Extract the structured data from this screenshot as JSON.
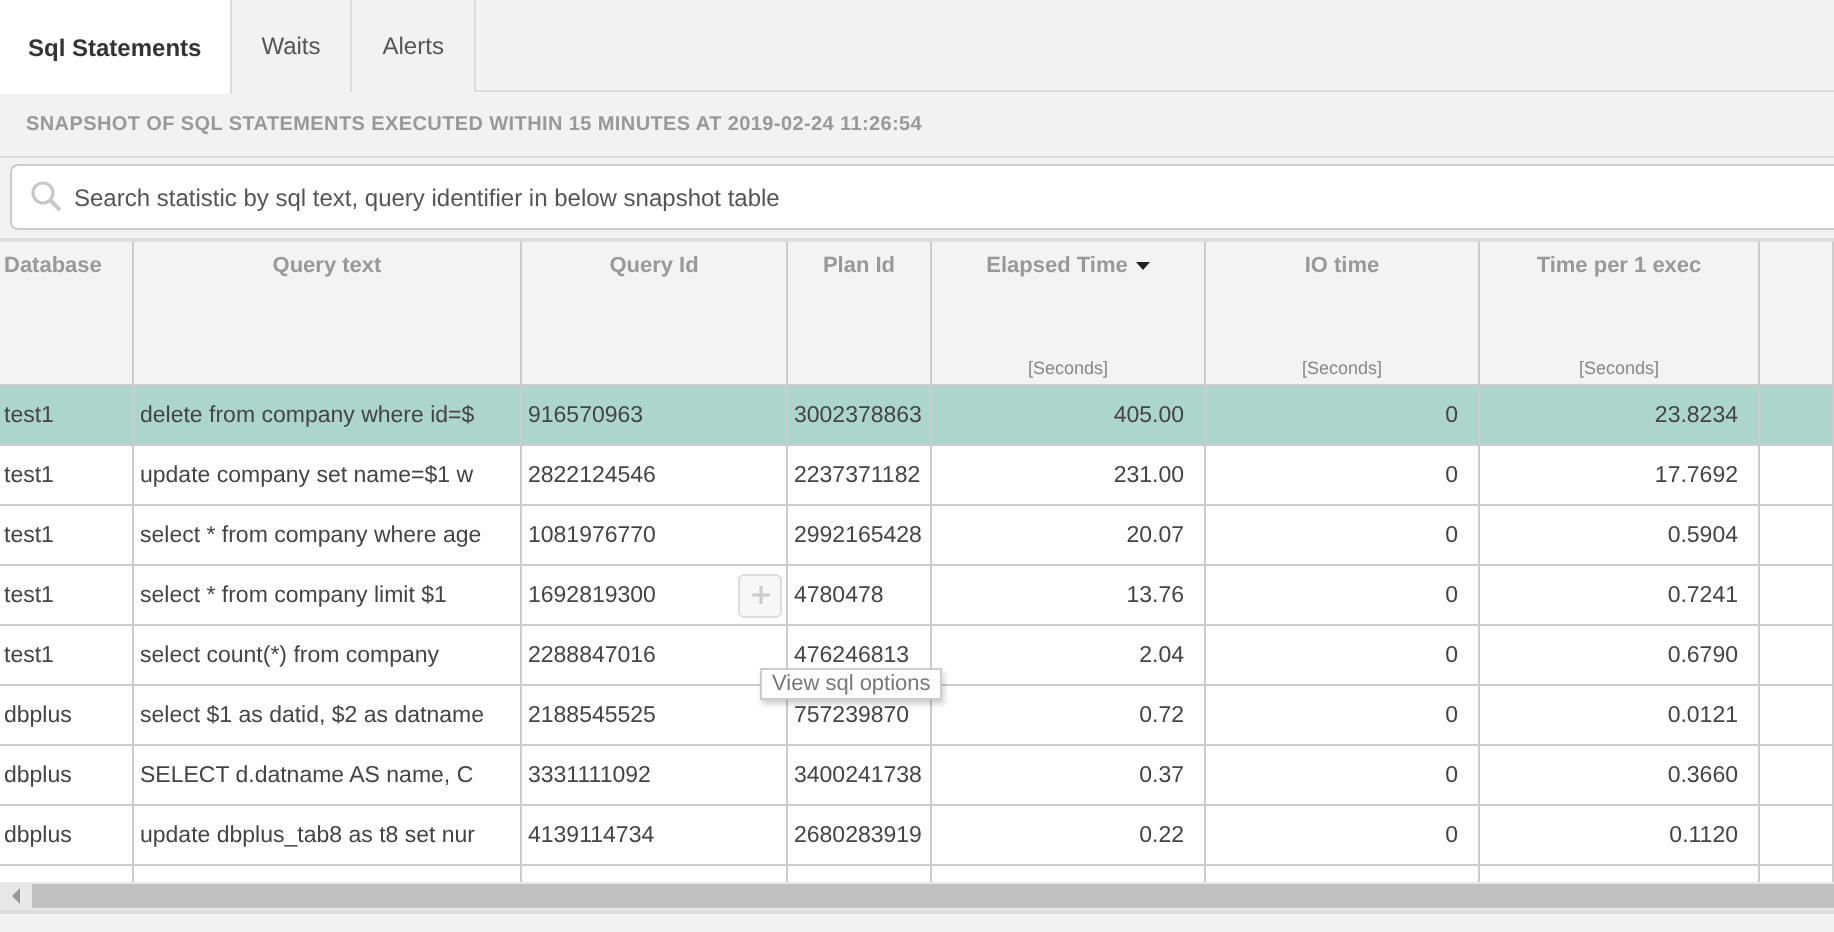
{
  "tabs": [
    {
      "label": "Sql Statements",
      "selected": true
    },
    {
      "label": "Waits",
      "selected": false
    },
    {
      "label": "Alerts",
      "selected": false
    }
  ],
  "snapshot_title": "SNAPSHOT OF SQL STATEMENTS EXECUTED WITHIN 15 MINUTES AT 2019-02-24 11:26:54",
  "search": {
    "placeholder": "Search statistic by sql text, query identifier in below snapshot table"
  },
  "table": {
    "columns": [
      {
        "label": "Database",
        "sorted": false
      },
      {
        "label": "Query text",
        "sorted": false
      },
      {
        "label": "Query Id",
        "sorted": false
      },
      {
        "label": "Plan Id",
        "sorted": false
      },
      {
        "label": "Elapsed Time",
        "unit": "[Seconds]",
        "sorted": true
      },
      {
        "label": "IO time",
        "unit": "[Seconds]",
        "sorted": false
      },
      {
        "label": "Time per 1 exec",
        "unit": "[Seconds]",
        "sorted": false
      }
    ],
    "rows": [
      {
        "selected": true,
        "cells": [
          "test1",
          "delete from company where id=$",
          "916570963",
          "3002378863",
          "405.00",
          "0",
          "23.8234"
        ]
      },
      {
        "selected": false,
        "cells": [
          "test1",
          "update company set name=$1 w",
          "2822124546",
          "2237371182",
          "231.00",
          "0",
          "17.7692"
        ]
      },
      {
        "selected": false,
        "cells": [
          "test1",
          "select * from company where age",
          "1081976770",
          "2992165428",
          "20.07",
          "0",
          "0.5904"
        ]
      },
      {
        "selected": false,
        "cells": [
          "test1",
          "select * from company limit $1",
          "1692819300",
          "4780478",
          "13.76",
          "0",
          "0.7241"
        ],
        "options_button": true
      },
      {
        "selected": false,
        "cells": [
          "test1",
          "select count(*) from company",
          "2288847016",
          "476246813",
          "2.04",
          "0",
          "0.6790"
        ]
      },
      {
        "selected": false,
        "cells": [
          "dbplus",
          "select $1 as datid, $2 as datname",
          "2188545525",
          "757239870",
          "0.72",
          "0",
          "0.0121"
        ]
      },
      {
        "selected": false,
        "cells": [
          "dbplus",
          "SELECT d.datname AS name, C",
          "3331111092",
          "3400241738",
          "0.37",
          "0",
          "0.3660"
        ]
      },
      {
        "selected": false,
        "cells": [
          "dbplus",
          "update dbplus_tab8 as t8 set nur",
          "4139114734",
          "2680283919",
          "0.22",
          "0",
          "0.1120"
        ]
      }
    ]
  },
  "tooltip": "View sql options"
}
